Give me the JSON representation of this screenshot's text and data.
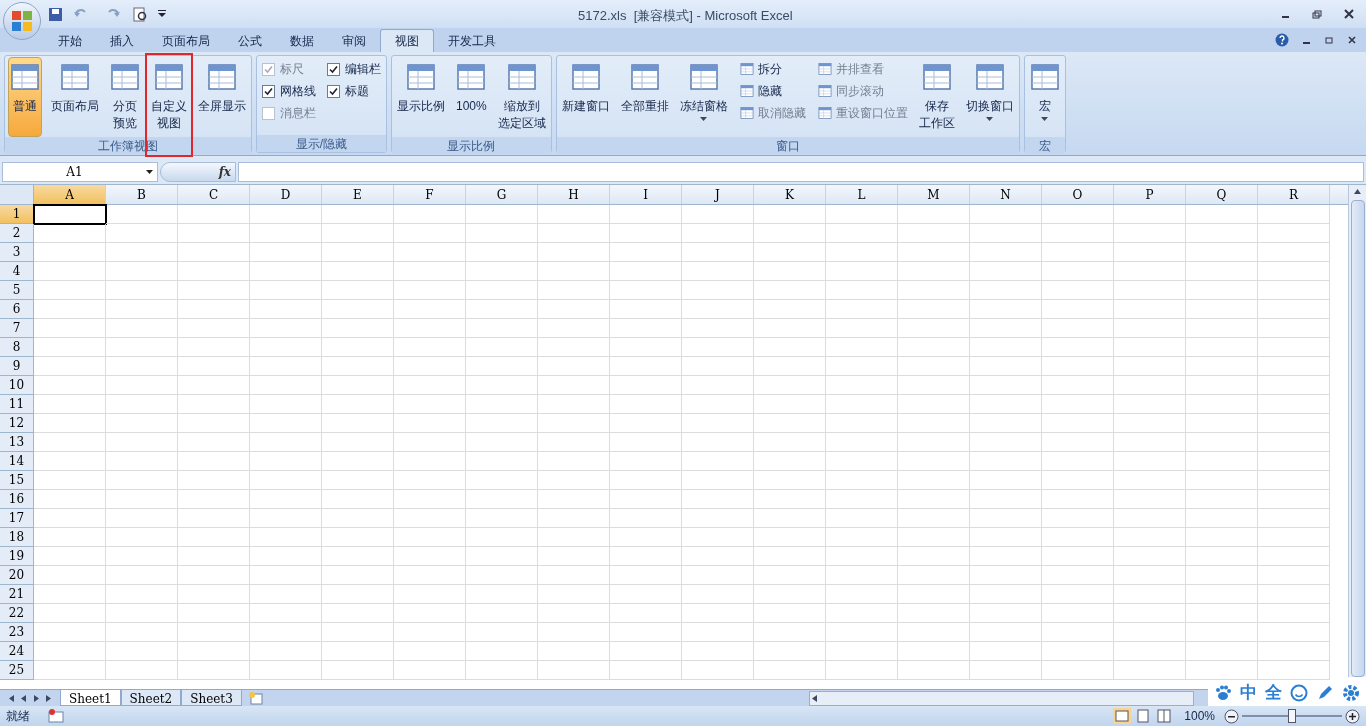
{
  "window": {
    "title": "5172.xls  [兼容模式] - Microsoft Excel"
  },
  "tabs": [
    {
      "label": "开始",
      "selected": false
    },
    {
      "label": "插入",
      "selected": false
    },
    {
      "label": "页面布局",
      "selected": false
    },
    {
      "label": "公式",
      "selected": false
    },
    {
      "label": "数据",
      "selected": false
    },
    {
      "label": "审阅",
      "selected": false
    },
    {
      "label": "视图",
      "selected": true
    },
    {
      "label": "开发工具",
      "selected": false
    }
  ],
  "ribbon": [
    {
      "label": "工作簿视图",
      "items": [
        {
          "kind": "large",
          "label": "普通",
          "selected": true,
          "highlighted": false,
          "dropdown": false
        },
        {
          "kind": "large",
          "label": "页面布局",
          "selected": false,
          "highlighted": false,
          "dropdown": false
        },
        {
          "kind": "large",
          "lines": [
            "分页",
            "预览"
          ],
          "selected": false,
          "highlighted": false,
          "dropdown": false
        },
        {
          "kind": "large",
          "lines": [
            "自定义",
            "视图"
          ],
          "selected": false,
          "highlighted": true,
          "dropdown": false
        },
        {
          "kind": "large",
          "label": "全屏显示",
          "selected": false,
          "highlighted": false,
          "dropdown": false
        }
      ]
    },
    {
      "label": "显示/隐藏",
      "items": [
        {
          "kind": "column",
          "entries": [
            {
              "kind": "checkbox",
              "label": "标尺",
              "checked": true,
              "disabled": true
            },
            {
              "kind": "checkbox",
              "label": "网格线",
              "checked": true,
              "disabled": false
            },
            {
              "kind": "checkbox",
              "label": "消息栏",
              "checked": false,
              "disabled": true
            }
          ]
        },
        {
          "kind": "column",
          "entries": [
            {
              "kind": "checkbox",
              "label": "编辑栏",
              "checked": true,
              "disabled": false
            },
            {
              "kind": "checkbox",
              "label": "标题",
              "checked": true,
              "disabled": false
            }
          ]
        }
      ]
    },
    {
      "label": "显示比例",
      "items": [
        {
          "kind": "large",
          "label": "显示比例",
          "selected": false,
          "highlighted": false,
          "dropdown": false
        },
        {
          "kind": "large",
          "label": "100%",
          "selected": false,
          "highlighted": false,
          "dropdown": false
        },
        {
          "kind": "large",
          "lines": [
            "缩放到",
            "选定区域"
          ],
          "selected": false,
          "highlighted": false,
          "dropdown": false
        }
      ]
    },
    {
      "label": "窗口",
      "items": [
        {
          "kind": "large",
          "label": "新建窗口",
          "selected": false,
          "highlighted": false,
          "dropdown": false
        },
        {
          "kind": "large",
          "label": "全部重排",
          "selected": false,
          "highlighted": false,
          "dropdown": false
        },
        {
          "kind": "large",
          "label": "冻结窗格",
          "selected": false,
          "highlighted": false,
          "dropdown": true
        },
        {
          "kind": "column",
          "entries": [
            {
              "kind": "small",
              "label": "拆分",
              "disabled": false
            },
            {
              "kind": "small",
              "label": "隐藏",
              "disabled": false
            },
            {
              "kind": "small",
              "label": "取消隐藏",
              "disabled": true
            }
          ]
        },
        {
          "kind": "column",
          "entries": [
            {
              "kind": "small",
              "label": "并排查看",
              "disabled": true
            },
            {
              "kind": "small",
              "label": "同步滚动",
              "disabled": true
            },
            {
              "kind": "small",
              "label": "重设窗口位置",
              "disabled": true
            }
          ]
        },
        {
          "kind": "large",
          "lines": [
            "保存",
            "工作区"
          ],
          "selected": false,
          "highlighted": false,
          "dropdown": false
        },
        {
          "kind": "large",
          "label": "切换窗口",
          "selected": false,
          "highlighted": false,
          "dropdown": true
        }
      ]
    },
    {
      "label": "宏",
      "items": [
        {
          "kind": "large",
          "label": "宏",
          "selected": false,
          "highlighted": false,
          "dropdown": true
        }
      ]
    }
  ],
  "formula_bar": {
    "name_box": "A1",
    "fx": "fx"
  },
  "sheet": {
    "columns": [
      {
        "label": "A",
        "selected": true
      },
      {
        "label": "B",
        "selected": false
      },
      {
        "label": "C",
        "selected": false
      },
      {
        "label": "D",
        "selected": false
      },
      {
        "label": "E",
        "selected": false
      },
      {
        "label": "F",
        "selected": false
      },
      {
        "label": "G",
        "selected": false
      },
      {
        "label": "H",
        "selected": false
      },
      {
        "label": "I",
        "selected": false
      },
      {
        "label": "J",
        "selected": false
      },
      {
        "label": "K",
        "selected": false
      },
      {
        "label": "L",
        "selected": false
      },
      {
        "label": "M",
        "selected": false
      },
      {
        "label": "N",
        "selected": false
      },
      {
        "label": "O",
        "selected": false
      },
      {
        "label": "P",
        "selected": false
      },
      {
        "label": "Q",
        "selected": false
      },
      {
        "label": "R",
        "selected": false
      }
    ],
    "rows": [
      {
        "label": "1",
        "selected": true
      },
      {
        "label": "2",
        "selected": false
      },
      {
        "label": "3",
        "selected": false
      },
      {
        "label": "4",
        "selected": false
      },
      {
        "label": "5",
        "selected": false
      },
      {
        "label": "6",
        "selected": false
      },
      {
        "label": "7",
        "selected": false
      },
      {
        "label": "8",
        "selected": false
      },
      {
        "label": "9",
        "selected": false
      },
      {
        "label": "10",
        "selected": false
      },
      {
        "label": "11",
        "selected": false
      },
      {
        "label": "12",
        "selected": false
      },
      {
        "label": "13",
        "selected": false
      },
      {
        "label": "14",
        "selected": false
      },
      {
        "label": "15",
        "selected": false
      },
      {
        "label": "16",
        "selected": false
      },
      {
        "label": "17",
        "selected": false
      },
      {
        "label": "18",
        "selected": false
      },
      {
        "label": "19",
        "selected": false
      },
      {
        "label": "20",
        "selected": false
      },
      {
        "label": "21",
        "selected": false
      },
      {
        "label": "22",
        "selected": false
      },
      {
        "label": "23",
        "selected": false
      },
      {
        "label": "24",
        "selected": false
      },
      {
        "label": "25",
        "selected": false
      }
    ]
  },
  "sheet_tabs": [
    {
      "label": "Sheet1",
      "selected": true
    },
    {
      "label": "Sheet2",
      "selected": false
    },
    {
      "label": "Sheet3",
      "selected": false
    }
  ],
  "status_bar": {
    "status": "就绪",
    "zoom": "100%",
    "zoom_slider": {
      "level": 0.5
    }
  },
  "ime_bar": [
    "中",
    "全"
  ]
}
